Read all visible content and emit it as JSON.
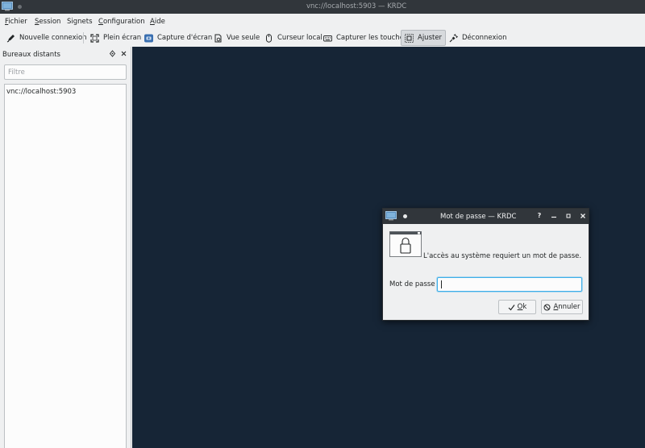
{
  "window": {
    "title": "vnc://localhost:5903 — KRDC"
  },
  "menubar": {
    "items": [
      {
        "label": "Fichier",
        "accel": "F",
        "rest": "ichier"
      },
      {
        "label": "Session",
        "accel": "S",
        "rest": "ession"
      },
      {
        "label": "Signets",
        "accel": "",
        "rest": "Signets"
      },
      {
        "label": "Configuration",
        "accel": "C",
        "rest": "onfiguration"
      },
      {
        "label": "Aide",
        "accel": "A",
        "rest": "ide"
      }
    ]
  },
  "toolbar": {
    "new_connection": "Nouvelle connexion",
    "fullscreen": "Plein écran",
    "screenshot": "Capture d'écran",
    "view_only": "Vue seule",
    "local_cursor": "Curseur local",
    "grab_keys": "Capturer les touches",
    "scale": "Ajuster",
    "disconnect": "Déconnexion"
  },
  "panel": {
    "title": "Bureaux distants",
    "filter_placeholder": "Filtre",
    "items": [
      "vnc://localhost:5903"
    ]
  },
  "dialog": {
    "title": "Mot de passe — KRDC",
    "help": "?",
    "message": "L'accès au système requiert un mot de passe.",
    "password_label": "Mot de passe :",
    "password_value": "",
    "ok_accel": "O",
    "ok_rest": "k",
    "cancel_accel": "A",
    "cancel_rest": "nnuler"
  },
  "colors": {
    "remote_background": "#162536",
    "titlebar": "#31363b",
    "focus": "#3daee9",
    "toolbar_bg": "#eff0f1"
  }
}
